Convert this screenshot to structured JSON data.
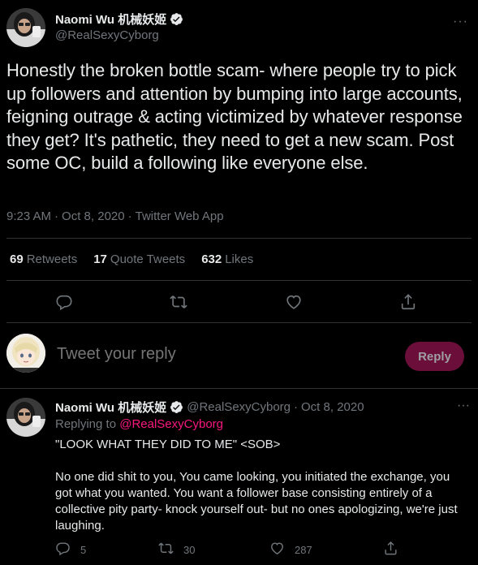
{
  "main_tweet": {
    "display_name": "Naomi Wu 机械妖姬",
    "handle": "@RealSexyCyborg",
    "more": "···",
    "text": "Honestly the broken bottle scam- where people try to pick up followers and attention by bumping into large accounts, feigning outrage & acting victimized by whatever response they get? It's pathetic, they need to get a new scam. Post some OC, build a following like everyone else.",
    "time": "9:23 AM",
    "sep1": "·",
    "date": "Oct 8, 2020",
    "sep2": "·",
    "source": "Twitter Web App",
    "stats": {
      "retweets_num": "69",
      "retweets_label": "Retweets",
      "quotes_num": "17",
      "quotes_label": "Quote Tweets",
      "likes_num": "632",
      "likes_label": "Likes"
    },
    "actions": [
      "reply-icon",
      "retweet-icon",
      "like-icon",
      "share-icon"
    ]
  },
  "reply_box": {
    "placeholder": "Tweet your reply",
    "button_label": "Reply"
  },
  "reply_tweet": {
    "display_name": "Naomi Wu 机械妖姬",
    "handle": "@RealSexyCyborg",
    "sep": "·",
    "date": "Oct 8, 2020",
    "more": "···",
    "replying_prefix": "Replying to",
    "replying_to": "@RealSexyCyborg",
    "body_line1": "\"LOOK WHAT THEY DID TO ME\" <SOB>",
    "body_para2": "No one did shit to you, You came looking, you initiated the exchange, you got what you wanted. You want a follower base consisting entirely of a collective pity party- knock yourself out- but no ones apologizing, we're just laughing.",
    "reply_count": "5",
    "retweet_count": "30",
    "like_count": "287"
  },
  "colors": {
    "background": "#000000",
    "text": "#e7e9ea",
    "muted": "#71767b",
    "accent": "#f91880",
    "verified": "#1d9bf0",
    "reply_button": "#6b0f3a"
  }
}
